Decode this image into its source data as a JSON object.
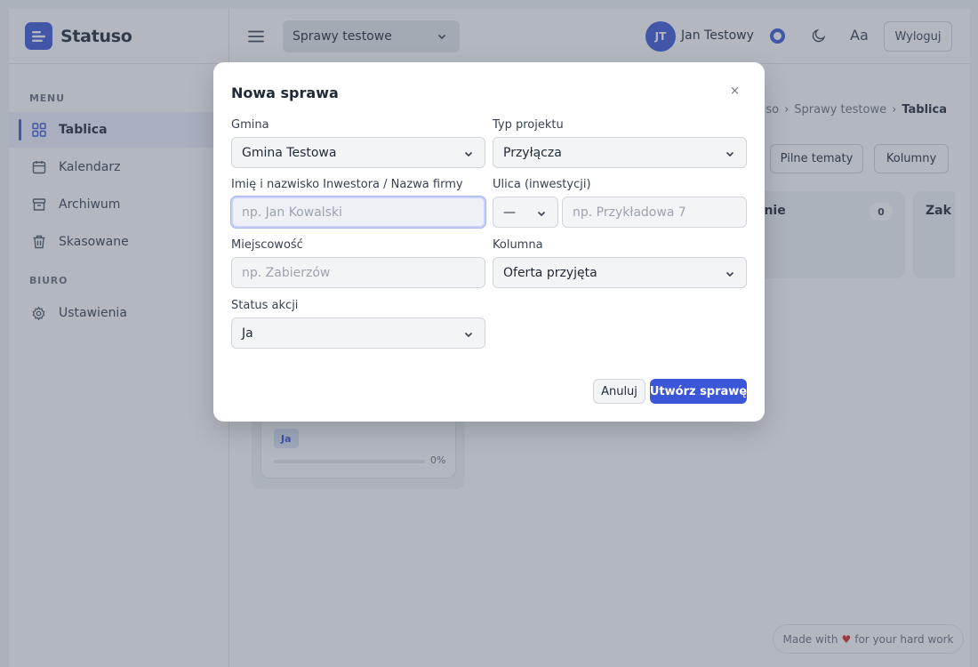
{
  "app": {
    "name": "Statuso",
    "brand_color": "#3b56d6"
  },
  "sidebar": {
    "menu_title": "MENU",
    "items": [
      {
        "label": "Tablica",
        "icon": "grid-icon",
        "active": true
      },
      {
        "label": "Kalendarz",
        "icon": "calendar-icon",
        "active": false
      },
      {
        "label": "Archiwum",
        "icon": "archive-icon",
        "active": false
      },
      {
        "label": "Skasowane",
        "icon": "trash-icon",
        "active": false
      }
    ],
    "office_title": "BIURO",
    "office_items": [
      {
        "label": "Ustawienia",
        "icon": "gear-icon"
      }
    ]
  },
  "topbar": {
    "project": "Sprawy testowe",
    "user_initials": "JT",
    "user_name": "Jan Testowy",
    "font_size_label": "Aa",
    "logout_label": "Wyloguj"
  },
  "main": {
    "breadcrumb": [
      "tuso",
      "Sprawy testowe",
      "Tablica"
    ],
    "buttons": {
      "urgent": "Pilne tematy",
      "columns": "Kolumny"
    },
    "columns": [
      {
        "title": "anie",
        "count": "0"
      },
      {
        "title": "Zak"
      }
    ],
    "card": {
      "badge": "Ja",
      "progress_pct": 0,
      "progress_label": "0%"
    },
    "footer": {
      "made_with": "Made with",
      "for_your": "for your hard work"
    }
  },
  "modal": {
    "title": "Nowa sprawa",
    "close": "×",
    "fields": {
      "gmina": {
        "label": "Gmina",
        "value": "Gmina Testowa"
      },
      "typ_projektu": {
        "label": "Typ projektu",
        "value": "Przyłącza"
      },
      "inwestor": {
        "label": "Imię i nazwisko Inwestora / Nazwa firmy",
        "placeholder": "np. Jan Kowalski"
      },
      "ulica": {
        "label": "Ulica (inwestycji)",
        "prefix_value": "—",
        "placeholder": "np. Przykładowa 7"
      },
      "miejscowosc": {
        "label": "Miejscowość",
        "placeholder": "np. Zabierzów"
      },
      "kolumna": {
        "label": "Kolumna",
        "value": "Oferta przyjęta"
      },
      "status": {
        "label": "Status akcji",
        "value": "Ja"
      }
    },
    "cancel_label": "Anuluj",
    "submit_label": "Utwórz sprawę"
  }
}
